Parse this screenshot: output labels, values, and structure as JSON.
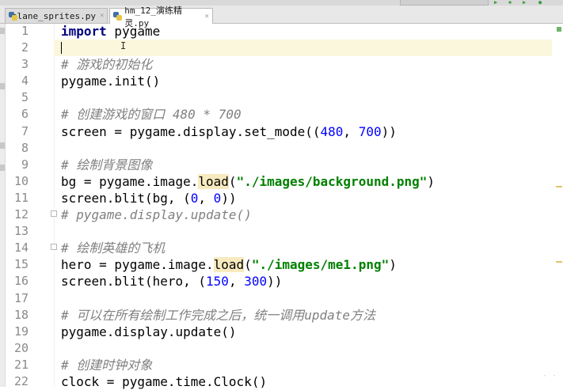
{
  "tabs": [
    {
      "label": "plane_sprites.py",
      "close": "×"
    },
    {
      "label": "hm_12_演练精灵.py",
      "close": "×"
    }
  ],
  "lines": [
    {
      "n": "1"
    },
    {
      "n": "2"
    },
    {
      "n": "3"
    },
    {
      "n": "4"
    },
    {
      "n": "5"
    },
    {
      "n": "6"
    },
    {
      "n": "7"
    },
    {
      "n": "8"
    },
    {
      "n": "9"
    },
    {
      "n": "10"
    },
    {
      "n": "11"
    },
    {
      "n": "12"
    },
    {
      "n": "13"
    },
    {
      "n": "14"
    },
    {
      "n": "15"
    },
    {
      "n": "16"
    },
    {
      "n": "17"
    },
    {
      "n": "18"
    },
    {
      "n": "19"
    },
    {
      "n": "20"
    },
    {
      "n": "21"
    },
    {
      "n": "22"
    }
  ],
  "code": {
    "l1": {
      "kw": "import",
      "rest": " pygame"
    },
    "l3": "# 游戏的初始化",
    "l4": "pygame.init()",
    "l6": "# 创建游戏的窗口 480 * 700",
    "l7": {
      "a": "screen = pygame.display.set_mode((",
      "n1": "480",
      "b": ", ",
      "n2": "700",
      "c": "))"
    },
    "l9": "# 绘制背景图像",
    "l10": {
      "a": "bg = pygame.image.",
      "fn": "load",
      "b": "(",
      "s": "\"./images/background.png\"",
      "c": ")"
    },
    "l11": {
      "a": "screen.blit(bg, (",
      "n1": "0",
      "b": ", ",
      "n2": "0",
      "c": "))"
    },
    "l12": "# pygame.display.update()",
    "l14": "# 绘制英雄的飞机",
    "l15": {
      "a": "hero = pygame.image.",
      "fn": "load",
      "b": "(",
      "s": "\"./images/me1.png\"",
      "c": ")"
    },
    "l16": {
      "a": "screen.blit(hero, (",
      "n1": "150",
      "b": ", ",
      "n2": "300",
      "c": "))"
    },
    "l18": "# 可以在所有绘制工作完成之后，统一调用update方法",
    "l19": "pygame.display.update()",
    "l21": "# 创建时钟对象",
    "l22": "clock = pygame.time.Clock()"
  },
  "icons": {
    "tab_file_icon": "python-file-icon",
    "caret": "text-caret",
    "mouse": "ibeam-cursor-icon"
  }
}
